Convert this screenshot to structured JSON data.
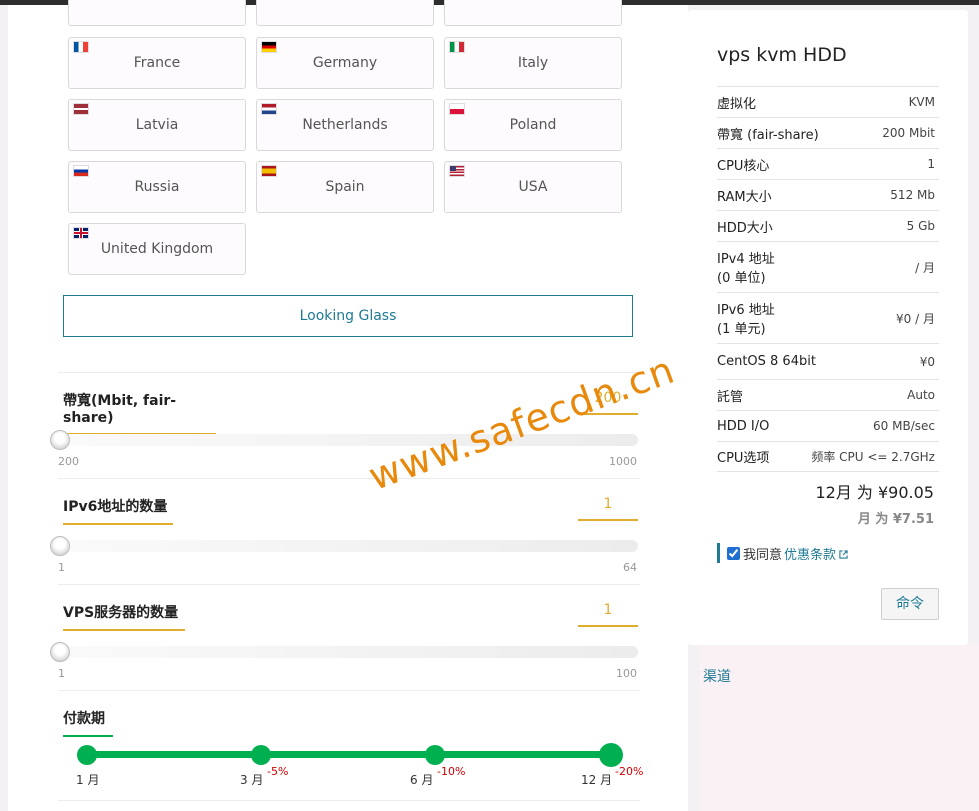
{
  "locations": [
    {
      "name": "France",
      "flag": "fr"
    },
    {
      "name": "Germany",
      "flag": "de"
    },
    {
      "name": "Italy",
      "flag": "it"
    },
    {
      "name": "Latvia",
      "flag": "lv"
    },
    {
      "name": "Netherlands",
      "flag": "nl"
    },
    {
      "name": "Poland",
      "flag": "pl"
    },
    {
      "name": "Russia",
      "flag": "ru"
    },
    {
      "name": "Spain",
      "flag": "es"
    },
    {
      "name": "USA",
      "flag": "us"
    },
    {
      "name": "United Kingdom",
      "flag": "gb"
    }
  ],
  "looking_glass_label": "Looking Glass",
  "sliders": {
    "bandwidth": {
      "title": "帶寬(Mbit, fair-share)",
      "value": "200",
      "min": "200",
      "max": "1000"
    },
    "ipv6": {
      "title": "IPv6地址的数量",
      "value": "1",
      "min": "1",
      "max": "64"
    },
    "servers": {
      "title": "VPS服务器的数量",
      "value": "1",
      "min": "1",
      "max": "100"
    }
  },
  "billing": {
    "title": "付款期",
    "terms": [
      {
        "label": "1 月",
        "discount": ""
      },
      {
        "label": "3 月",
        "discount": "-5%"
      },
      {
        "label": "6 月",
        "discount": "-10%"
      },
      {
        "label": "12 月",
        "discount": "-20%"
      }
    ],
    "selected_index": 3
  },
  "watermark": "www.safecdn.cn",
  "summary": {
    "title": "vps kvm HDD",
    "rows": [
      {
        "k": "虚拟化",
        "v": "KVM"
      },
      {
        "k": "帶寬 (fair-share)",
        "v": "200 Mbit"
      },
      {
        "k": "CPU核心",
        "v": "1"
      },
      {
        "k": "RAM大小",
        "v": "512 Mb"
      },
      {
        "k": "HDD大小",
        "v": "5 Gb"
      },
      {
        "k": "IPv4 地址",
        "k2": "(0 单位)",
        "v": "/ 月"
      },
      {
        "k": "IPv6 地址",
        "k2": "(1 单元)",
        "v": "¥0 / 月"
      },
      {
        "k": "CentOS 8 64bit",
        "v": "¥0"
      },
      {
        "k": "託管",
        "v": "Auto"
      },
      {
        "k": "HDD I/O",
        "v": "60 MB/sec"
      },
      {
        "k": "CPU选项",
        "v": "频率 CPU <= 2.7GHz"
      }
    ],
    "total": "12月 为 ¥90.05",
    "monthly": "月 为 ¥7.51",
    "agree_prefix": "我同意",
    "agree_link": "优惠条款",
    "order_label": "命令"
  },
  "channel_link": "渠道",
  "colors": {
    "accent": "#1f7a96",
    "slider_accent": "#e1ad2c",
    "term_green": "#00b050",
    "discount_red": "#cc0000"
  }
}
